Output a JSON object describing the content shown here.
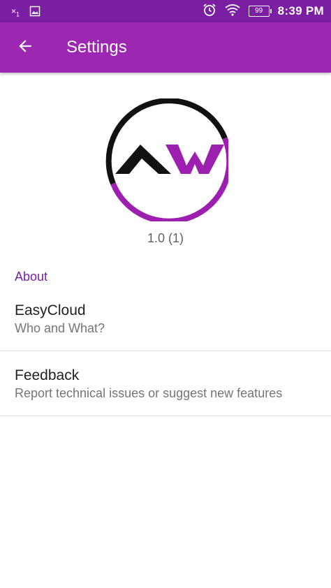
{
  "status_bar": {
    "notification_count": "×",
    "notification_sub": "1",
    "icons": [
      "close-icon",
      "image-icon",
      "alarm-icon",
      "wifi-icon",
      "battery-icon"
    ],
    "battery_level": "99",
    "time": "8:39 PM"
  },
  "app_bar": {
    "back_icon": "arrow-back-icon",
    "title": "Settings"
  },
  "header": {
    "logo_text": "AW",
    "version": "1.0 (1)"
  },
  "about_section": {
    "title": "About",
    "items": [
      {
        "title": "EasyCloud",
        "summary": "Who and What?"
      },
      {
        "title": "Feedback",
        "summary": "Report technical issues or suggest new features"
      }
    ]
  },
  "colors": {
    "status_bar": "#7b1fa2",
    "app_bar": "#9c27b0",
    "accent": "#7b1fa2",
    "logo_black": "#111111",
    "logo_purple": "#9c1fb0"
  }
}
